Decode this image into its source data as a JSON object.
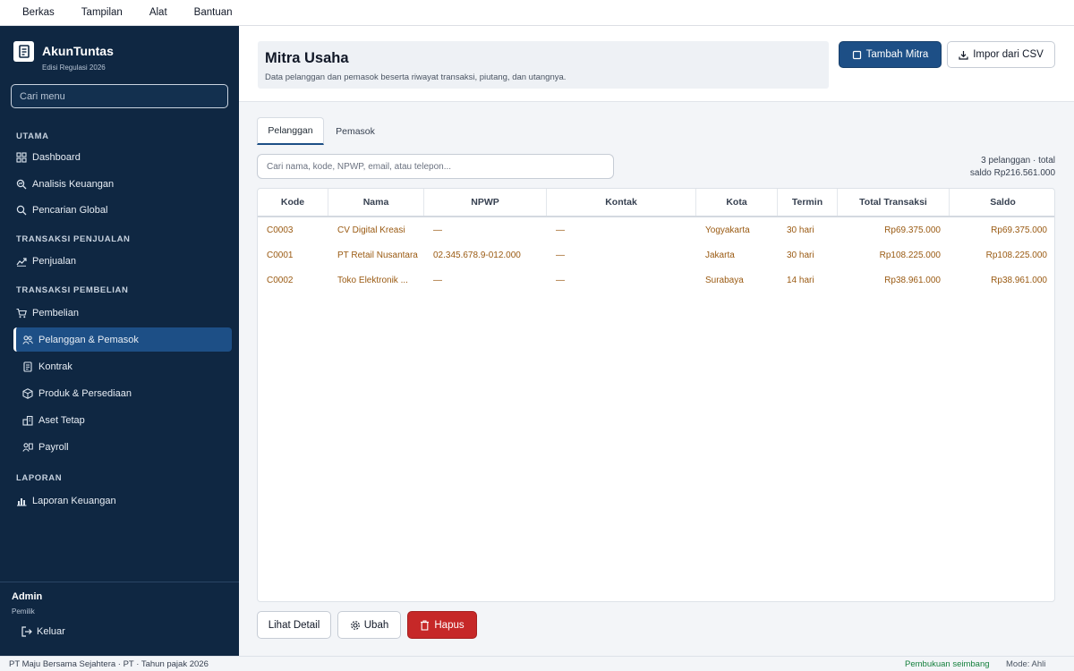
{
  "menubar": {
    "items": [
      "Berkas",
      "Tampilan",
      "Alat",
      "Bantuan"
    ]
  },
  "sidebar": {
    "brand": {
      "name": "AkunTuntas",
      "edition": "Edisi Regulasi 2026"
    },
    "search_placeholder": "Cari menu",
    "sections": {
      "utama": "UTAMA",
      "penjualan": "TRANSAKSI PENJUALAN",
      "pembelian": "TRANSAKSI PEMBELIAN",
      "laporan": "LAPORAN"
    },
    "items": [
      {
        "label": "Dashboard",
        "icon": "grid-icon"
      },
      {
        "label": "Analisis Keuangan",
        "icon": "analysis-icon"
      },
      {
        "label": "Pencarian Global",
        "icon": "search-icon"
      },
      {
        "label": "Penjualan",
        "icon": "trend-icon"
      },
      {
        "label": "Pembelian",
        "icon": "cart-icon"
      },
      {
        "label": "Pelanggan & Pemasok",
        "icon": "people-icon",
        "active": true
      },
      {
        "label": "Kontrak",
        "icon": "document-icon"
      },
      {
        "label": "Produk & Persediaan",
        "icon": "box-icon"
      },
      {
        "label": "Aset Tetap",
        "icon": "building-icon"
      },
      {
        "label": "Payroll",
        "icon": "payroll-icon"
      },
      {
        "label": "Laporan Keuangan",
        "icon": "bar-chart-icon"
      }
    ],
    "user": {
      "name": "Admin",
      "role": "Pemilik"
    },
    "logout_label": "Keluar"
  },
  "header": {
    "title": "Mitra Usaha",
    "subtitle": "Data pelanggan dan pemasok beserta riwayat transaksi, piutang, dan utangnya.",
    "add_button": "Tambah Mitra",
    "import_button": "Impor dari CSV"
  },
  "tabs": [
    {
      "label": "Pelanggan",
      "active": true
    },
    {
      "label": "Pemasok",
      "active": false
    }
  ],
  "search": {
    "placeholder": "Cari nama, kode, NPWP, email, atau telepon..."
  },
  "summary": {
    "line1": "3 pelanggan · total",
    "line2": "saldo Rp216.561.000"
  },
  "table": {
    "columns": [
      "Kode",
      "Nama",
      "NPWP",
      "Kontak",
      "Kota",
      "Termin",
      "Total Transaksi",
      "Saldo"
    ],
    "rows": [
      [
        "C0003",
        "CV Digital Kreasi",
        "—",
        "—",
        "Yogyakarta",
        "30 hari",
        "Rp69.375.000",
        "Rp69.375.000"
      ],
      [
        "C0001",
        "PT Retail Nusantara",
        "02.345.678.9-012.000",
        "—",
        "Jakarta",
        "30 hari",
        "Rp108.225.000",
        "Rp108.225.000"
      ],
      [
        "C0002",
        "Toko Elektronik ...",
        "—",
        "—",
        "Surabaya",
        "14 hari",
        "Rp38.961.000",
        "Rp38.961.000"
      ]
    ]
  },
  "actions": {
    "detail": "Lihat Detail",
    "edit": "Ubah",
    "delete": "Hapus"
  },
  "statusbar": {
    "left": "PT Maju Bersama Sejahtera · PT · Tahun pajak 2026",
    "balance": "Pembukuan seimbang",
    "mode": "Mode: Ahli"
  },
  "colors": {
    "sidebar_bg": "#0f2742",
    "accent": "#1d4f86",
    "danger": "#c62828",
    "row_text": "#9a5a12",
    "ok": "#15803d"
  }
}
